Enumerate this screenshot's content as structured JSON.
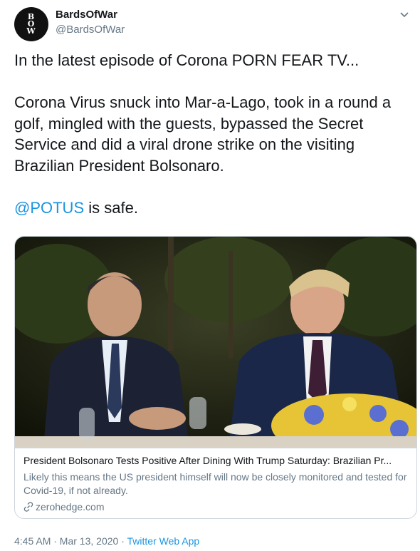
{
  "author": {
    "avatar_letters": [
      "B",
      "O",
      "W"
    ],
    "name": "BardsOfWar",
    "handle": "@BardsOfWar"
  },
  "tweet": {
    "line1": "In the latest episode of Corona PORN FEAR TV...",
    "paragraph2": "Corona Virus snuck into Mar-a-Lago, took in a round a golf, mingled with the guests, bypassed the Secret Service and did a viral drone strike on the visiting Brazilian President Bolsonaro.",
    "mention": "@POTUS",
    "mention_suffix": " is safe."
  },
  "card": {
    "title": "President Bolsonaro Tests Positive After Dining With Trump Saturday: Brazilian Pr...",
    "description": "Likely this means the US president himself will now be closely monitored and tested for Covid-19, if not already.",
    "domain": "zerohedge.com"
  },
  "meta": {
    "timestamp": "4:45 AM · Mar 13, 2020 · ",
    "app": "Twitter Web App"
  },
  "colors": {
    "link": "#1b95e0",
    "secondary_text": "#657786",
    "border": "#ccd6dd"
  },
  "icons": {
    "more": "chevron-down-icon",
    "link": "link-icon"
  }
}
